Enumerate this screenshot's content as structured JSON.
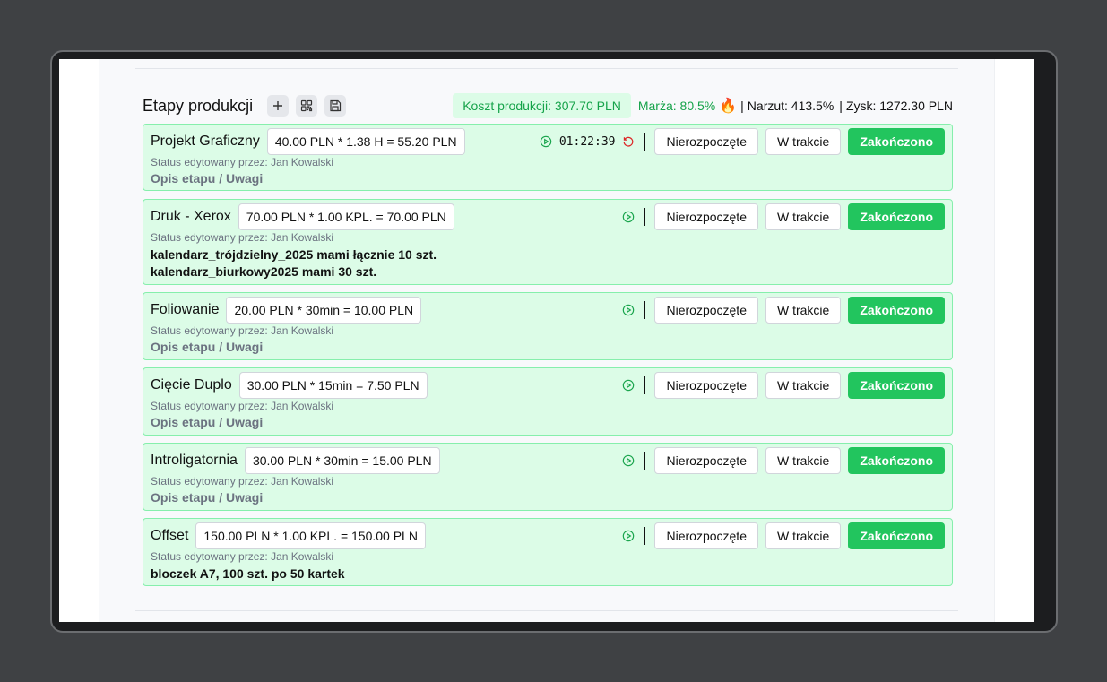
{
  "header": {
    "title": "Etapy produkcji",
    "koszt": "Koszt produkcji: 307.70 PLN",
    "marza": "Marża: 80.5%",
    "fire_emoji": "🔥",
    "narzut": "Narzut: 413.5%",
    "zysk": "Zysk: 1272.30 PLN",
    "sep": "|"
  },
  "icons": {
    "add": "plus-icon",
    "qr": "qr-code-icon",
    "save": "save-icon",
    "play": "play-circle-icon",
    "reset": "reset-icon"
  },
  "buttons": {
    "not_started": "Nierozpoczęte",
    "in_progress": "W trakcie",
    "done": "Zakończono"
  },
  "status_by": "Status edytowany przez: Jan Kowalski",
  "stages": [
    {
      "name": "Projekt Graficzny",
      "calc": "40.00 PLN * 1.38 H = 55.20 PLN",
      "timer": "01:22:39",
      "notes": "Opis etapu / Uwagi"
    },
    {
      "name": "Druk - Xerox",
      "calc": "70.00 PLN * 1.00 KPL. = 70.00 PLN",
      "notes_line1": "kalendarz_trójdzielny_2025 mami łącznie 10 szt.",
      "notes_line2": "kalendarz_biurkowy2025 mami 30 szt."
    },
    {
      "name": "Foliowanie",
      "calc": "20.00 PLN * 30min = 10.00 PLN",
      "notes": "Opis etapu / Uwagi"
    },
    {
      "name": "Cięcie Duplo",
      "calc": "30.00 PLN * 15min = 7.50 PLN",
      "notes": "Opis etapu / Uwagi"
    },
    {
      "name": "Introligatornia",
      "calc": "30.00 PLN * 30min = 15.00 PLN",
      "notes": "Opis etapu / Uwagi"
    },
    {
      "name": "Offset",
      "calc": "150.00 PLN * 1.00 KPL. = 150.00 PLN",
      "notes_line1": "bloczek A7, 100 szt. po 50 kartek"
    }
  ],
  "colors": {
    "accent_green": "#22c55e",
    "stage_bg": "#dcfce7",
    "stage_border": "#86efac",
    "reset_red": "#dc2626"
  }
}
